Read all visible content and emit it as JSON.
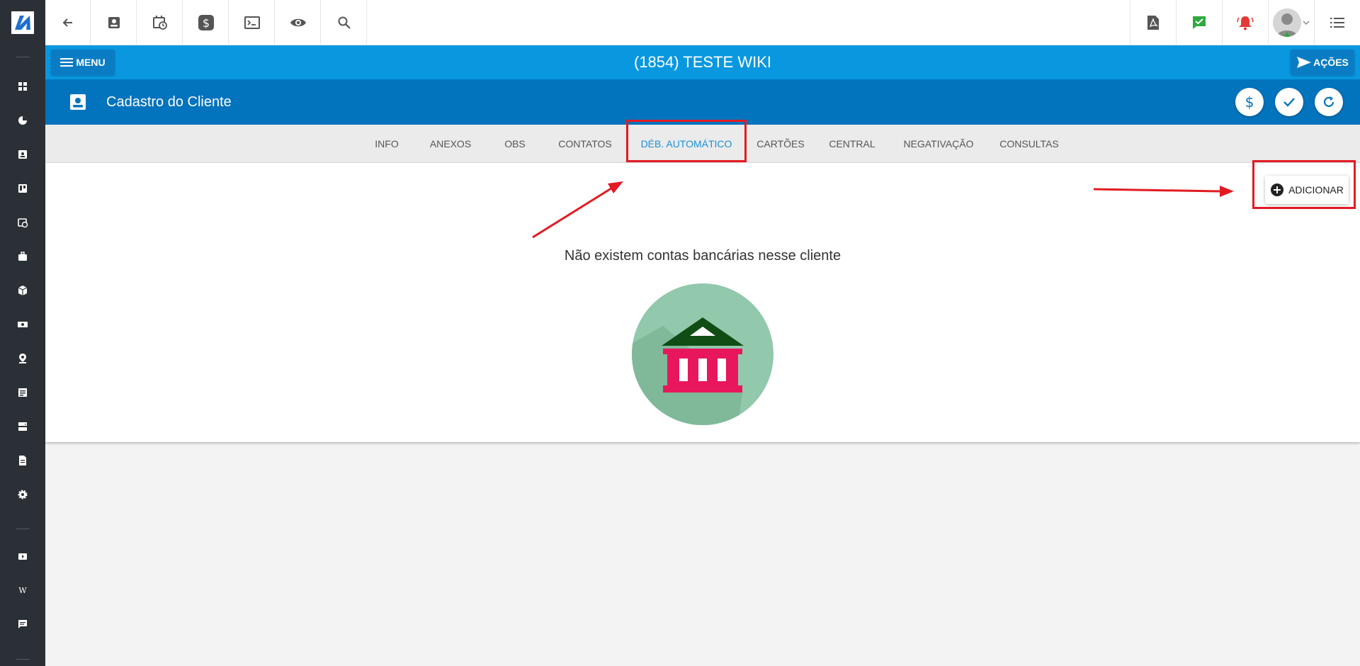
{
  "topbar": {
    "left_icons": [
      "back-arrow-icon",
      "contact-card-icon",
      "calendar-clock-icon",
      "dollar-icon",
      "terminal-icon",
      "eye-icon",
      "search-icon"
    ],
    "right_icons": [
      "pdf-icon",
      "chat-check-icon",
      "alarm-bell-icon",
      "user-avatar",
      "list-icon"
    ]
  },
  "titlebar": {
    "menu_label": "MENU",
    "title": "(1854) TESTE WIKI",
    "actions_label": "AÇÕES"
  },
  "section": {
    "title": "Cadastro do Cliente",
    "buttons": [
      "dollar-icon",
      "check-icon",
      "refresh-icon"
    ]
  },
  "tabs": [
    {
      "label": "INFO",
      "active": false
    },
    {
      "label": "ANEXOS",
      "active": false
    },
    {
      "label": "OBS",
      "active": false
    },
    {
      "label": "CONTATOS",
      "active": false
    },
    {
      "label": "DÉB. AUTOMÁTICO",
      "active": true
    },
    {
      "label": "CARTÕES",
      "active": false
    },
    {
      "label": "CENTRAL",
      "active": false
    },
    {
      "label": "NEGATIVAÇÃO",
      "active": false
    },
    {
      "label": "CONSULTAS",
      "active": false
    }
  ],
  "content": {
    "add_label": "ADICIONAR",
    "empty_message": "Não existem contas bancárias nesse cliente"
  },
  "colors": {
    "sidebar": "#2b2f36",
    "titlebar": "#0998e0",
    "sectionbar": "#0273bd",
    "active_tab": "#1a8fd8",
    "annotation": "#e21b23"
  }
}
